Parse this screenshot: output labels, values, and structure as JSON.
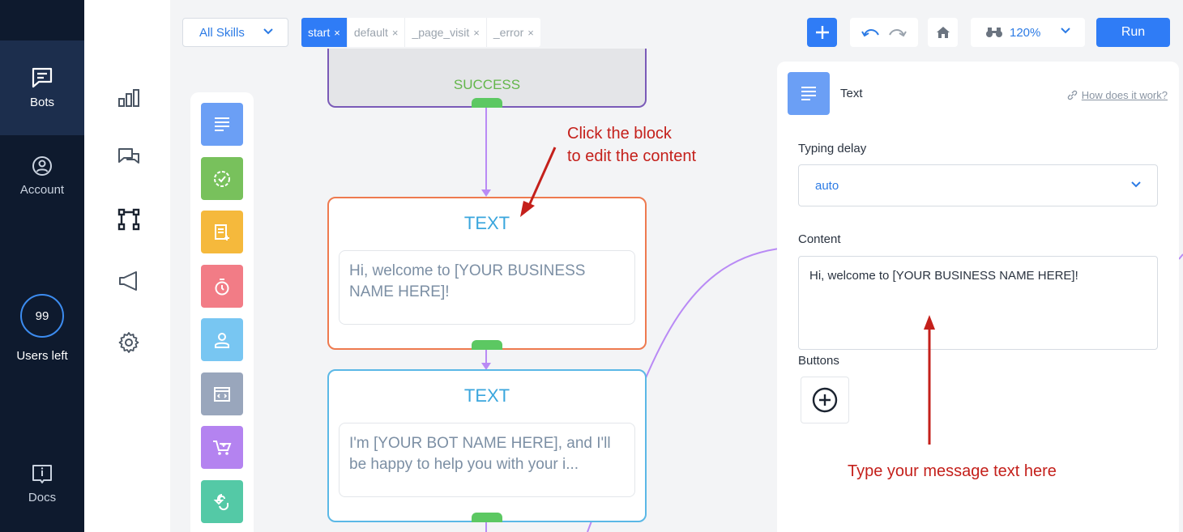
{
  "sidebar": {
    "items": [
      {
        "label": "Bots",
        "icon": "chat-box-icon",
        "active": true
      },
      {
        "label": "Account",
        "icon": "user-circle-icon",
        "active": false
      }
    ],
    "users_left": {
      "count": "99",
      "label": "Users left"
    },
    "docs": {
      "label": "Docs",
      "icon": "book-info-icon"
    }
  },
  "tool_column": {
    "icons": [
      "analytics-icon",
      "conversations-icon",
      "flow-builder-icon",
      "broadcast-icon",
      "settings-icon"
    ]
  },
  "toolbar": {
    "skills_select": "All Skills",
    "tags": [
      {
        "label": "start",
        "active": true
      },
      {
        "label": "default",
        "active": false
      },
      {
        "label": "_page_visit",
        "active": false
      },
      {
        "label": "_error",
        "active": false
      }
    ],
    "tag_close": "×",
    "zoom": "120%",
    "run_label": "Run"
  },
  "palette": {
    "items": [
      {
        "name": "text-block-icon",
        "color": "#6b9ff5"
      },
      {
        "name": "check-block-icon",
        "color": "#78c15c"
      },
      {
        "name": "form-block-icon",
        "color": "#f5b93c"
      },
      {
        "name": "timer-block-icon",
        "color": "#f27c86"
      },
      {
        "name": "user-block-icon",
        "color": "#78c6f2"
      },
      {
        "name": "code-block-icon",
        "color": "#99a6bc"
      },
      {
        "name": "cart-block-icon",
        "color": "#b483f0"
      },
      {
        "name": "integration-block-icon",
        "color": "#54c9a6"
      }
    ]
  },
  "flow": {
    "success_label": "SUCCESS",
    "blocks": [
      {
        "title": "TEXT",
        "body": "Hi, welcome to [YOUR BUSINESS NAME HERE]!"
      },
      {
        "title": "TEXT",
        "body": "I'm [YOUR BOT NAME HERE], and I'll be happy to help you with your i..."
      }
    ]
  },
  "annotations": {
    "click_block": "Click the block\nto edit the content",
    "type_message": "Type your message text here"
  },
  "panel": {
    "title": "Text",
    "help_link": "How does it work?",
    "typing_delay_label": "Typing delay",
    "typing_delay_value": "auto",
    "content_label": "Content",
    "content_value": "Hi, welcome to [YOUR BUSINESS NAME HERE]!",
    "buttons_label": "Buttons"
  },
  "colors": {
    "sidebar_bg": "#0e1a2e",
    "accent": "#2f7cf6",
    "annotation": "#c4201b",
    "success": "#63b64a"
  }
}
